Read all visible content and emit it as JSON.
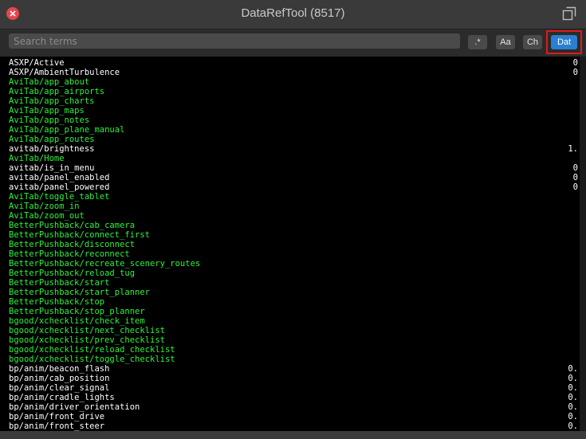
{
  "window": {
    "title": "DataRefTool (8517)"
  },
  "search": {
    "placeholder": "Search terms",
    "value": ""
  },
  "toolbar": {
    "regex_label": ".*",
    "case_label": "Aa",
    "changed_label": "Ch",
    "datarefs_label": "Dat"
  },
  "colors": {
    "dataref": "#ffffff",
    "command": "#2ef23a",
    "active_button": "#2a7fcf",
    "highlight": "#e01b1b"
  },
  "rows": [
    {
      "name": "ASXP/Active",
      "value": "0",
      "kind": "dataref"
    },
    {
      "name": "ASXP/AmbientTurbulence",
      "value": "0",
      "kind": "dataref"
    },
    {
      "name": "AviTab/app_about",
      "value": "",
      "kind": "command"
    },
    {
      "name": "AviTab/app_airports",
      "value": "",
      "kind": "command"
    },
    {
      "name": "AviTab/app_charts",
      "value": "",
      "kind": "command"
    },
    {
      "name": "AviTab/app_maps",
      "value": "",
      "kind": "command"
    },
    {
      "name": "AviTab/app_notes",
      "value": "",
      "kind": "command"
    },
    {
      "name": "AviTab/app_plane_manual",
      "value": "",
      "kind": "command"
    },
    {
      "name": "AviTab/app_routes",
      "value": "",
      "kind": "command"
    },
    {
      "name": "avitab/brightness",
      "value": "1.",
      "kind": "dataref"
    },
    {
      "name": "AviTab/Home",
      "value": "",
      "kind": "command"
    },
    {
      "name": "avitab/is_in_menu",
      "value": "0",
      "kind": "dataref"
    },
    {
      "name": "avitab/panel_enabled",
      "value": "0",
      "kind": "dataref"
    },
    {
      "name": "avitab/panel_powered",
      "value": "0",
      "kind": "dataref"
    },
    {
      "name": "AviTab/toggle_tablet",
      "value": "",
      "kind": "command"
    },
    {
      "name": "AviTab/zoom_in",
      "value": "",
      "kind": "command"
    },
    {
      "name": "AviTab/zoom_out",
      "value": "",
      "kind": "command"
    },
    {
      "name": "BetterPushback/cab_camera",
      "value": "",
      "kind": "command"
    },
    {
      "name": "BetterPushback/connect_first",
      "value": "",
      "kind": "command"
    },
    {
      "name": "BetterPushback/disconnect",
      "value": "",
      "kind": "command"
    },
    {
      "name": "BetterPushback/reconnect",
      "value": "",
      "kind": "command"
    },
    {
      "name": "BetterPushback/recreate_scenery_routes",
      "value": "",
      "kind": "command"
    },
    {
      "name": "BetterPushback/reload_tug",
      "value": "",
      "kind": "command"
    },
    {
      "name": "BetterPushback/start",
      "value": "",
      "kind": "command"
    },
    {
      "name": "BetterPushback/start_planner",
      "value": "",
      "kind": "command"
    },
    {
      "name": "BetterPushback/stop",
      "value": "",
      "kind": "command"
    },
    {
      "name": "BetterPushback/stop_planner",
      "value": "",
      "kind": "command"
    },
    {
      "name": "bgood/xchecklist/check_item",
      "value": "",
      "kind": "command"
    },
    {
      "name": "bgood/xchecklist/next_checklist",
      "value": "",
      "kind": "command"
    },
    {
      "name": "bgood/xchecklist/prev_checklist",
      "value": "",
      "kind": "command"
    },
    {
      "name": "bgood/xchecklist/reload_checklist",
      "value": "",
      "kind": "command"
    },
    {
      "name": "bgood/xchecklist/toggle_checklist",
      "value": "",
      "kind": "command"
    },
    {
      "name": "bp/anim/beacon_flash",
      "value": "0.",
      "kind": "dataref"
    },
    {
      "name": "bp/anim/cab_position",
      "value": "0.",
      "kind": "dataref"
    },
    {
      "name": "bp/anim/clear_signal",
      "value": "0.",
      "kind": "dataref"
    },
    {
      "name": "bp/anim/cradle_lights",
      "value": "0.",
      "kind": "dataref"
    },
    {
      "name": "bp/anim/driver_orientation",
      "value": "0.",
      "kind": "dataref"
    },
    {
      "name": "bp/anim/front_drive",
      "value": "0.",
      "kind": "dataref"
    },
    {
      "name": "bp/anim/front_steer",
      "value": "0.",
      "kind": "dataref"
    }
  ]
}
